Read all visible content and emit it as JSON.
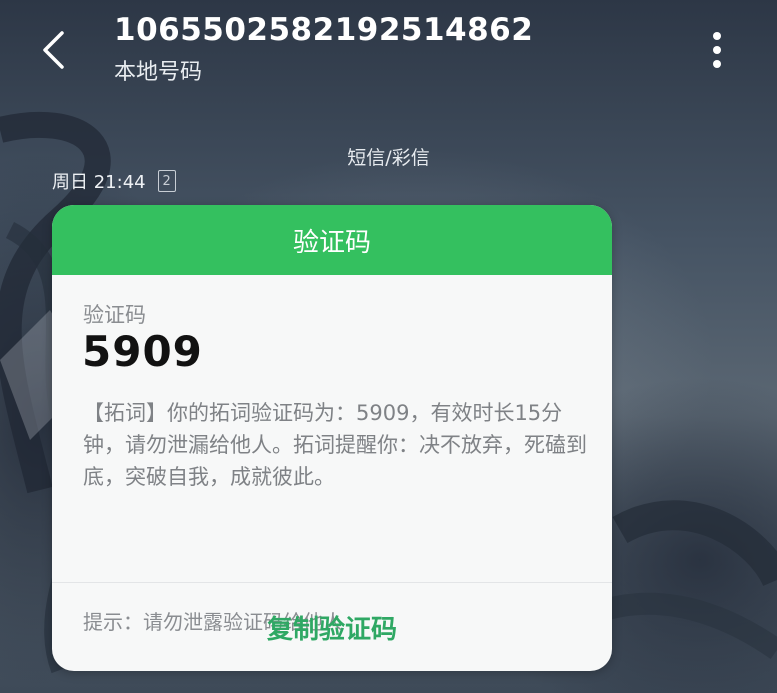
{
  "header": {
    "title": "1065502582192514862",
    "subtitle": "本地号码"
  },
  "conversation": {
    "channel_label": "短信/彩信",
    "timestamp": "周日 21:44",
    "sim_slot": "2"
  },
  "card": {
    "header_title": "验证码",
    "code_label": "验证码",
    "code_value": "5909",
    "message": "【拓词】你的拓词验证码为：5909，有效时长15分钟，请勿泄漏给他人。拓词提醒你：决不放弃，死磕到底，突破自我，成就彼此。",
    "hint": "提示：请勿泄露验证码给他人",
    "copy_button": "复制验证码"
  },
  "colors": {
    "accent_green": "#34c05f",
    "copy_text_green": "#2fa864"
  },
  "icons": {
    "back": "back-arrow-icon",
    "more": "more-vertical-icon",
    "sim": "sim-card-icon"
  }
}
